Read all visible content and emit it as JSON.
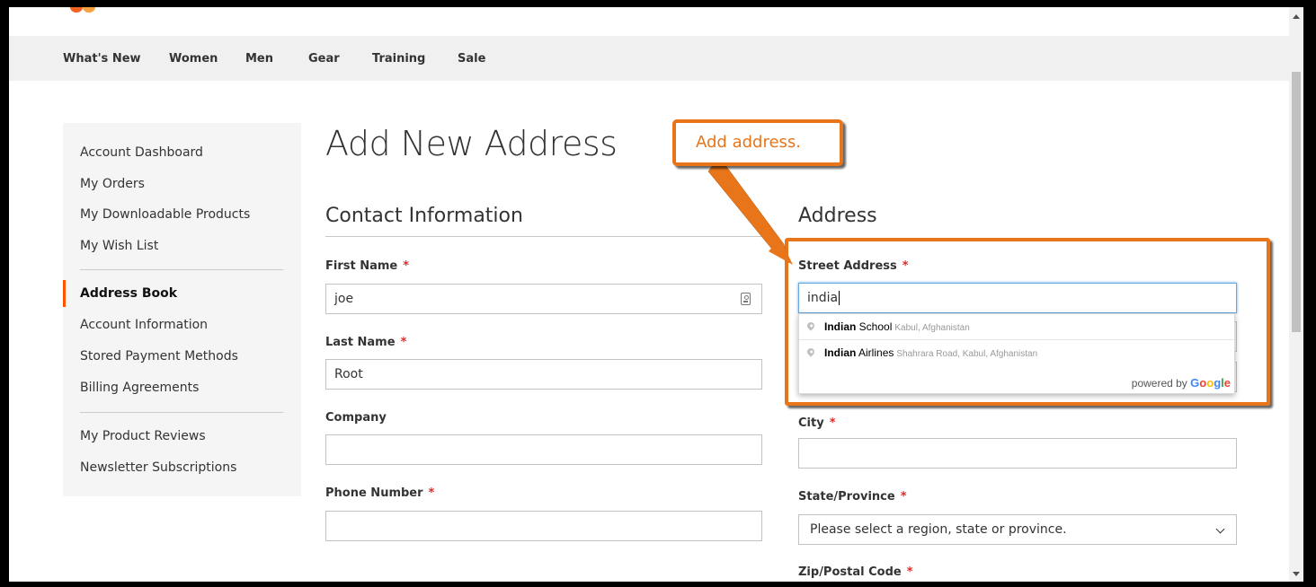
{
  "nav": {
    "items": [
      "What's New",
      "Women",
      "Men",
      "Gear",
      "Training",
      "Sale"
    ]
  },
  "sidebar": {
    "items": [
      "Account Dashboard",
      "My Orders",
      "My Downloadable Products",
      "My Wish List",
      "Address Book",
      "Account Information",
      "Stored Payment Methods",
      "Billing Agreements",
      "My Product Reviews",
      "Newsletter Subscriptions"
    ],
    "active": "Address Book"
  },
  "page": {
    "title": "Add New Address"
  },
  "contact": {
    "heading": "Contact Information",
    "first_name_label": "First Name",
    "first_name_value": "joe",
    "last_name_label": "Last Name",
    "last_name_value": "Root",
    "company_label": "Company",
    "company_value": "",
    "phone_label": "Phone Number",
    "phone_value": ""
  },
  "address": {
    "heading": "Address",
    "street_label": "Street Address",
    "street_value": "india",
    "city_label": "City",
    "city_value": "",
    "state_label": "State/Province",
    "state_value": "Please select a region, state or province.",
    "zip_label": "Zip/Postal Code"
  },
  "required_marker": "*",
  "autocomplete": {
    "suggestions": [
      {
        "match": "Indian",
        "rest": " School",
        "secondary": "Kabul, Afghanistan"
      },
      {
        "match": "Indian",
        "rest": " Airlines",
        "secondary": "Shahrara Road, Kabul, Afghanistan"
      }
    ],
    "powered_by": "powered by",
    "google": [
      "G",
      "o",
      "o",
      "g",
      "l",
      "e"
    ]
  },
  "annotation": {
    "callout_text": "Add address."
  },
  "colors": {
    "accent": "#e8751a",
    "required": "#e02b27",
    "active_bar": "#ff5501",
    "google": [
      "#4285F4",
      "#EA4335",
      "#FBBC05",
      "#4285F4",
      "#34A853",
      "#EA4335"
    ]
  }
}
